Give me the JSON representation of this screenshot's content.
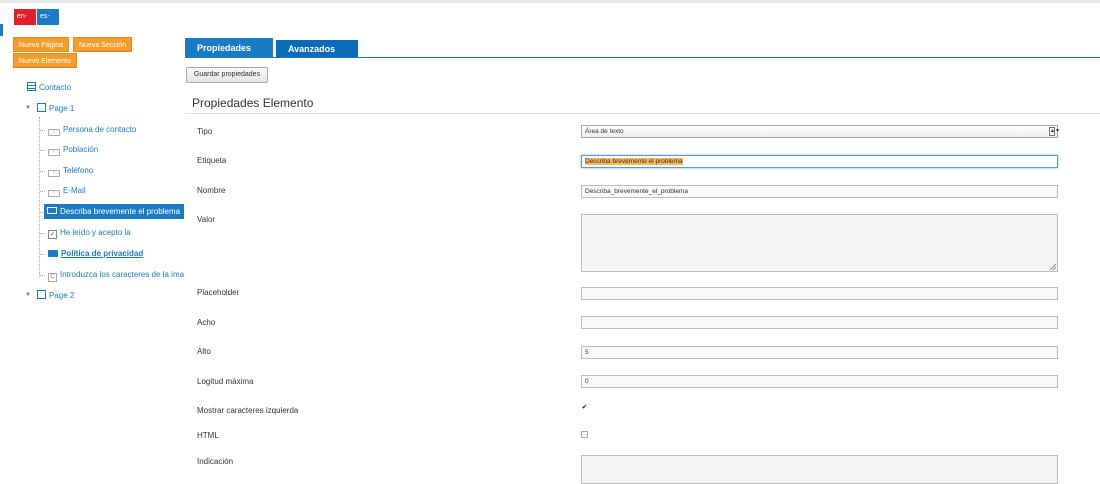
{
  "languages": [
    "en-GB",
    "es-ES"
  ],
  "actions": {
    "new_page": "Nueva Página",
    "new_section": "Nueva Sección",
    "new_element": "Nuevo Elemento"
  },
  "tree": {
    "form": "Contacto",
    "page1": "Page 1",
    "items": [
      "Persona de contacto",
      "Población",
      "Teléfono",
      "E-Mail",
      "Describa brevemente el problema",
      "He leído y acepto la",
      "Política de privacidad",
      "Introduzca los caracteres de la ima"
    ],
    "page2": "Page 2"
  },
  "tabs": [
    "Propiedades",
    "Avanzados"
  ],
  "save_label": "Guardar propiedades",
  "section_title": "Propiedades Elemento",
  "fields": {
    "tipo": {
      "label": "Tipo",
      "value": "Área de texto"
    },
    "etiqueta": {
      "label": "Etiqueta",
      "value": "Describa brevemente el problema"
    },
    "nombre": {
      "label": "Nombre",
      "value": "Describa_brevemente_el_problema"
    },
    "valor": {
      "label": "Valor",
      "value": ""
    },
    "placeholder": {
      "label": "Placeholder",
      "value": ""
    },
    "ancho": {
      "label": "Acho",
      "value": ""
    },
    "alto": {
      "label": "Alto",
      "value": "5"
    },
    "longitud": {
      "label": "Logitud máxima",
      "value": "0"
    },
    "mostrar": {
      "label": "Mostrar caracteres izquierda",
      "checked": true
    },
    "html": {
      "label": "HTML",
      "checked": false
    },
    "indicacion": {
      "label": "Indicación",
      "value": ""
    }
  },
  "colors": {
    "accent": "#1a7bc4",
    "orange": "#f29d2e",
    "lang_gb": "#e0202a"
  }
}
